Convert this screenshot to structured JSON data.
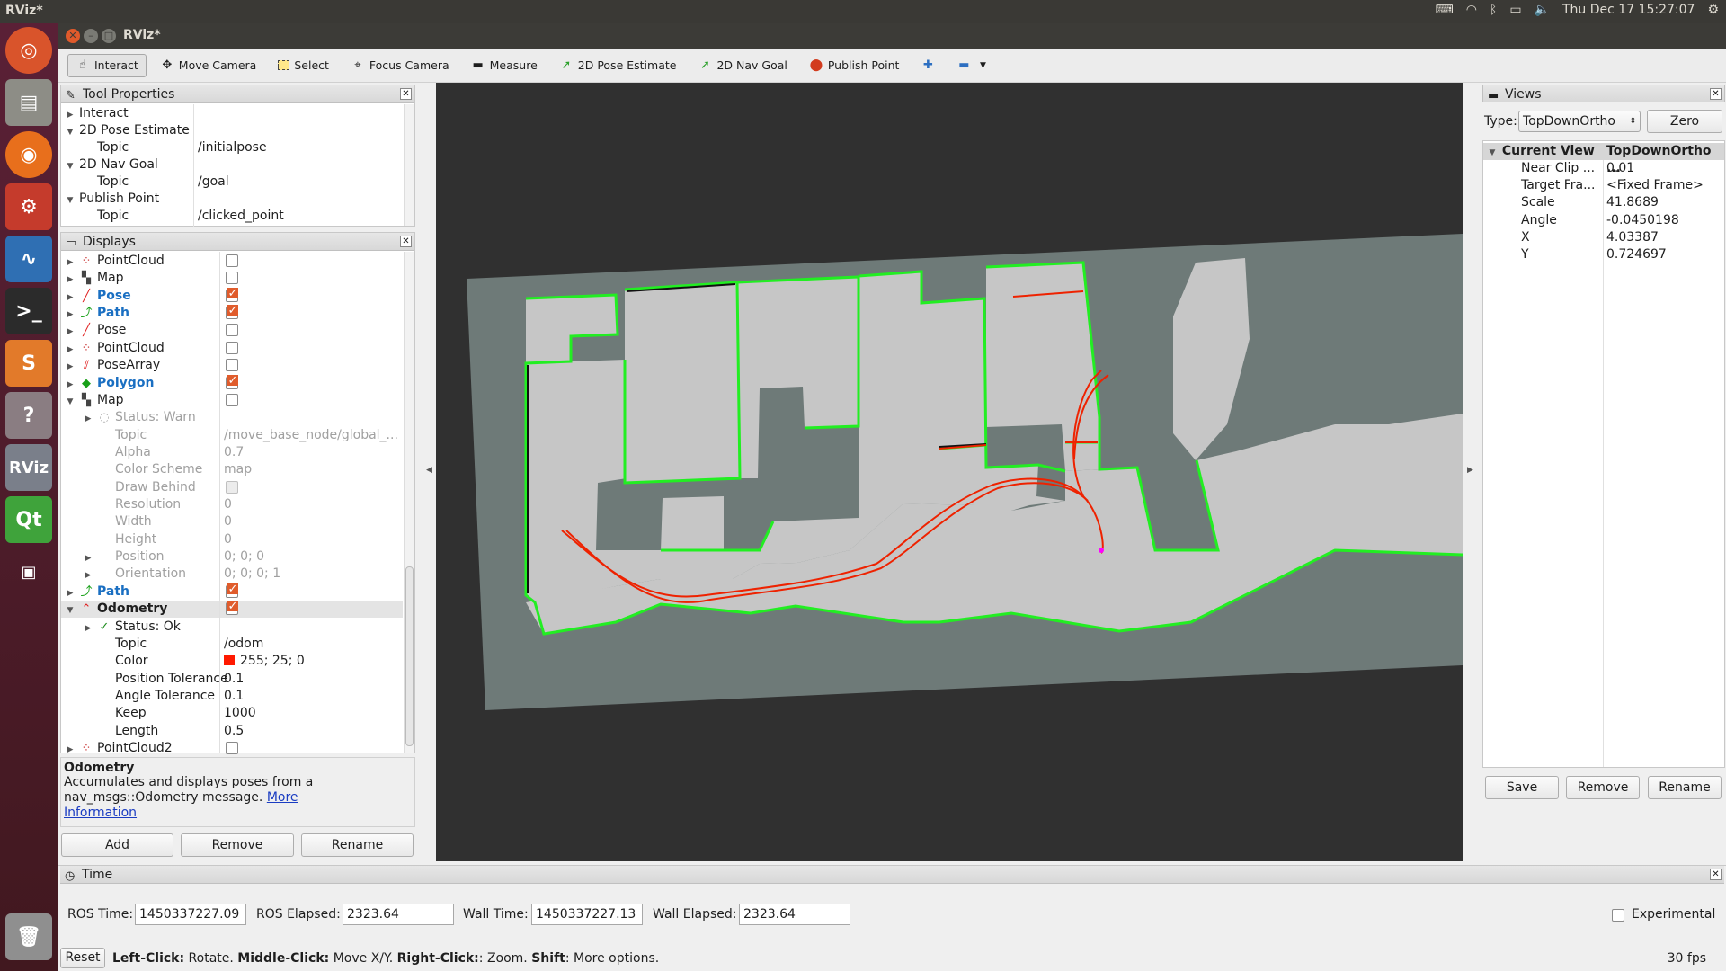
{
  "os": {
    "app_name": "RViz*",
    "clock": "Thu Dec 17 15:27:07"
  },
  "window": {
    "title": "RViz*"
  },
  "toolbar": {
    "items": [
      {
        "label": "Interact",
        "icon": "hand-icon",
        "active": true
      },
      {
        "label": "Move Camera",
        "icon": "move-icon"
      },
      {
        "label": "Select",
        "icon": "select-icon"
      },
      {
        "label": "Focus Camera",
        "icon": "focus-icon"
      },
      {
        "label": "Measure",
        "icon": "ruler-icon"
      },
      {
        "label": "2D Pose Estimate",
        "icon": "green-arrow-icon"
      },
      {
        "label": "2D Nav Goal",
        "icon": "green-arrow-icon"
      },
      {
        "label": "Publish Point",
        "icon": "pin-icon"
      }
    ]
  },
  "tool_properties": {
    "title": "Tool Properties",
    "rows": [
      {
        "label": "Interact",
        "value": "",
        "indent": 0,
        "arrow": "▶"
      },
      {
        "label": "2D Pose Estimate",
        "value": "",
        "indent": 0,
        "arrow": "▼"
      },
      {
        "label": "Topic",
        "value": "/initialpose",
        "indent": 1,
        "arrow": ""
      },
      {
        "label": "2D Nav Goal",
        "value": "",
        "indent": 0,
        "arrow": "▼"
      },
      {
        "label": "Topic",
        "value": "/goal",
        "indent": 1,
        "arrow": ""
      },
      {
        "label": "Publish Point",
        "value": "",
        "indent": 0,
        "arrow": "▼"
      },
      {
        "label": "Topic",
        "value": "/clicked_point",
        "indent": 1,
        "arrow": ""
      }
    ]
  },
  "displays": {
    "title": "Displays",
    "rows": [
      {
        "label": "PointCloud",
        "icon": "pointcloud-icon",
        "arrow": "▶",
        "checked": false,
        "indent": 0,
        "style": ""
      },
      {
        "label": "Map",
        "icon": "map-icon",
        "arrow": "▶",
        "checked": false,
        "indent": 0,
        "style": ""
      },
      {
        "label": "Pose",
        "icon": "pose-icon",
        "arrow": "▶",
        "checked": true,
        "indent": 0,
        "style": "blue"
      },
      {
        "label": "Path",
        "icon": "path-icon",
        "arrow": "▶",
        "checked": true,
        "indent": 0,
        "style": "blue"
      },
      {
        "label": "Pose",
        "icon": "pose-icon",
        "arrow": "▶",
        "checked": false,
        "indent": 0,
        "style": ""
      },
      {
        "label": "PointCloud",
        "icon": "pointcloud-icon",
        "arrow": "▶",
        "checked": false,
        "indent": 0,
        "style": ""
      },
      {
        "label": "PoseArray",
        "icon": "posearray-icon",
        "arrow": "▶",
        "checked": false,
        "indent": 0,
        "style": ""
      },
      {
        "label": "Polygon",
        "icon": "polygon-icon",
        "arrow": "▶",
        "checked": true,
        "indent": 0,
        "style": "blue"
      },
      {
        "label": "Map",
        "icon": "map-icon",
        "arrow": "▼",
        "checked": false,
        "indent": 0,
        "style": ""
      },
      {
        "label": "Status: Warn",
        "icon": "warn-icon",
        "arrow": "▶",
        "indent": 1,
        "style": "grey",
        "value": ""
      },
      {
        "label": "Topic",
        "arrow": "",
        "indent": 1,
        "style": "grey",
        "value": "/move_base_node/global_..."
      },
      {
        "label": "Alpha",
        "arrow": "",
        "indent": 1,
        "style": "grey",
        "value": "0.7"
      },
      {
        "label": "Color Scheme",
        "arrow": "",
        "indent": 1,
        "style": "grey",
        "value": "map"
      },
      {
        "label": "Draw Behind",
        "arrow": "",
        "indent": 1,
        "style": "grey",
        "value": "",
        "checkbox": true
      },
      {
        "label": "Resolution",
        "arrow": "",
        "indent": 1,
        "style": "grey",
        "value": "0"
      },
      {
        "label": "Width",
        "arrow": "",
        "indent": 1,
        "style": "grey",
        "value": "0"
      },
      {
        "label": "Height",
        "arrow": "",
        "indent": 1,
        "style": "grey",
        "value": "0"
      },
      {
        "label": "Position",
        "arrow": "▶",
        "indent": 1,
        "style": "grey",
        "value": "0; 0; 0"
      },
      {
        "label": "Orientation",
        "arrow": "▶",
        "indent": 1,
        "style": "grey",
        "value": "0; 0; 0; 1"
      },
      {
        "label": "Path",
        "icon": "path-icon",
        "arrow": "▶",
        "checked": true,
        "indent": 0,
        "style": "blue"
      },
      {
        "label": "Odometry",
        "icon": "odometry-icon",
        "arrow": "▼",
        "checked": true,
        "indent": 0,
        "style": "bold",
        "selected": true
      },
      {
        "label": "Status: Ok",
        "icon": "ok-icon",
        "arrow": "▶",
        "indent": 1,
        "style": "",
        "value": ""
      },
      {
        "label": "Topic",
        "arrow": "",
        "indent": 1,
        "style": "",
        "value": "/odom"
      },
      {
        "label": "Color",
        "arrow": "",
        "indent": 1,
        "style": "",
        "value": "255; 25; 0",
        "swatch": "#ff1900"
      },
      {
        "label": "Position Tolerance",
        "arrow": "",
        "indent": 1,
        "style": "",
        "value": "0.1"
      },
      {
        "label": "Angle Tolerance",
        "arrow": "",
        "indent": 1,
        "style": "",
        "value": "0.1"
      },
      {
        "label": "Keep",
        "arrow": "",
        "indent": 1,
        "style": "",
        "value": "1000"
      },
      {
        "label": "Length",
        "arrow": "",
        "indent": 1,
        "style": "",
        "value": "0.5"
      },
      {
        "label": "PointCloud2",
        "icon": "pointcloud-icon",
        "arrow": "▶",
        "checked": false,
        "indent": 0,
        "style": ""
      }
    ]
  },
  "description": {
    "title": "Odometry",
    "text": "Accumulates and displays poses from a nav_msgs::Odometry message.",
    "link": "More Information"
  },
  "display_buttons": {
    "add": "Add",
    "remove": "Remove",
    "rename": "Rename"
  },
  "views": {
    "title": "Views",
    "type_label": "Type:",
    "type_value": "TopDownOrtho",
    "zero": "Zero",
    "header": {
      "label": "Current View",
      "value": "TopDownOrtho ..."
    },
    "rows": [
      {
        "label": "Near Clip ...",
        "value": "0.01"
      },
      {
        "label": "Target Fra...",
        "value": "<Fixed Frame>"
      },
      {
        "label": "Scale",
        "value": "41.8689"
      },
      {
        "label": "Angle",
        "value": "-0.0450198"
      },
      {
        "label": "X",
        "value": "4.03387"
      },
      {
        "label": "Y",
        "value": "0.724697"
      }
    ],
    "buttons": {
      "save": "Save",
      "remove": "Remove",
      "rename": "Rename"
    }
  },
  "time": {
    "title": "Time",
    "ros_time_label": "ROS Time:",
    "ros_time": "1450337227.09",
    "ros_elapsed_label": "ROS Elapsed:",
    "ros_elapsed": "2323.64",
    "wall_time_label": "Wall Time:",
    "wall_time": "1450337227.13",
    "wall_elapsed_label": "Wall Elapsed:",
    "wall_elapsed": "2323.64",
    "experimental": "Experimental"
  },
  "status": {
    "reset": "Reset",
    "help_parts": [
      [
        "Left-Click:",
        " Rotate. "
      ],
      [
        "Middle-Click:",
        " Move X/Y. "
      ],
      [
        "Right-Click:",
        ": Zoom. "
      ],
      [
        "Shift",
        ": More options."
      ]
    ],
    "fps": "30 fps"
  },
  "colors": {
    "viewport_bg": "#303030",
    "map_unknown": "#6e7a78",
    "map_free": "#c8c8c8",
    "costmap": "#22ee22",
    "path": "#ee2200"
  }
}
